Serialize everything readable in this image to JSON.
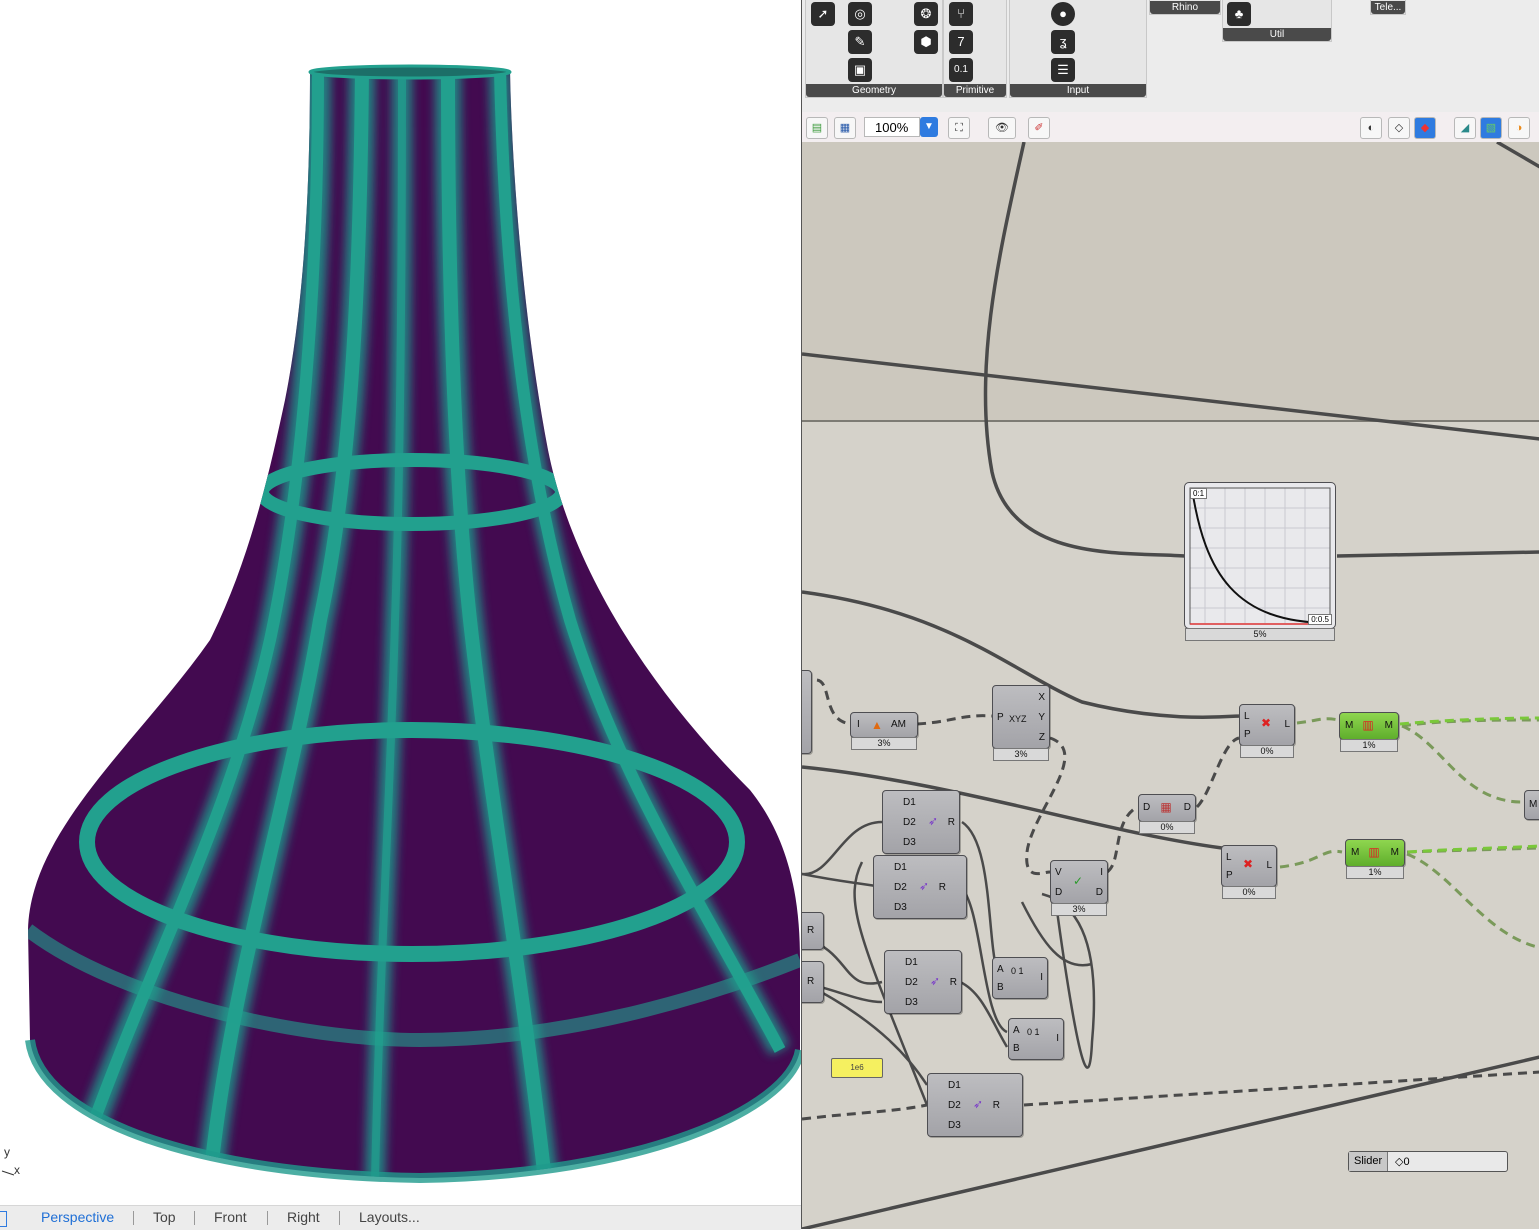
{
  "viewport": {
    "axis_y": "y",
    "axis_x": "x",
    "tabs": [
      "Perspective",
      "Top",
      "Front",
      "Right",
      "Layouts..."
    ],
    "active_tab": "Perspective",
    "colors": {
      "surface": "#430a50",
      "stripe": "#1f9a8c",
      "tab_active": "#1f6fd6"
    }
  },
  "grasshopper": {
    "ribbon": {
      "panels": [
        {
          "label": "Geometry",
          "icons": [
            "arrow-icon",
            "disc-icon",
            "wrench-icon",
            "sphere-icon",
            "panel-icon"
          ]
        },
        {
          "label": "Primitive",
          "icons": [
            "branch-icon",
            "integer-icon",
            "number-icon"
          ],
          "integer_glyph": "7",
          "number_glyph": "0.1"
        },
        {
          "label": "Input",
          "icons": [
            "toggle-icon",
            "gradient-icon",
            "list-icon"
          ]
        },
        {
          "label": "Rhino",
          "icons": []
        },
        {
          "label": "Util",
          "icons": [
            "tree-icon"
          ]
        },
        {
          "label": "Tele...",
          "icons": []
        }
      ]
    },
    "toolbar": {
      "zoom": "100%",
      "zoom_arrow": "▼"
    },
    "canvas": {
      "graph_mapper": {
        "label_tl": "0:1",
        "label_br": "0:0.5",
        "percent": "5%"
      },
      "components": [
        {
          "id": "am",
          "inputs": [
            "I"
          ],
          "outputs": [
            "AM"
          ],
          "percent": "3%"
        },
        {
          "id": "deconstruct",
          "inputs": [
            "P"
          ],
          "outputs": [
            "X",
            "Y",
            "Z"
          ],
          "center": "XYZ",
          "percent": "3%"
        },
        {
          "id": "cull1",
          "inputs": [
            "L",
            "P"
          ],
          "outputs": [
            "L"
          ],
          "percent": "0%"
        },
        {
          "id": "cull2",
          "inputs": [
            "L",
            "P"
          ],
          "outputs": [
            "L"
          ],
          "percent": "0%"
        },
        {
          "id": "mesh1",
          "inputs": [
            "M"
          ],
          "outputs": [
            "M"
          ],
          "percent": "1%"
        },
        {
          "id": "mesh2",
          "inputs": [
            "M"
          ],
          "outputs": [
            "M"
          ],
          "percent": "1%"
        },
        {
          "id": "dd",
          "inputs": [
            "D"
          ],
          "outputs": [
            "D"
          ],
          "percent": "0%"
        },
        {
          "id": "vd",
          "inputs": [
            "V",
            "D"
          ],
          "outputs": [
            "I",
            "D"
          ],
          "percent": "3%"
        },
        {
          "id": "rg1",
          "inputs": [
            "D1",
            "D2",
            "D3"
          ],
          "outputs": [
            "R"
          ],
          "percent": ""
        },
        {
          "id": "rg2",
          "inputs": [
            "D1",
            "D2",
            "D3"
          ],
          "outputs": [
            "R"
          ],
          "percent": ""
        },
        {
          "id": "rg3",
          "inputs": [
            "D1",
            "D2",
            "D3"
          ],
          "outputs": [
            "R"
          ],
          "percent": ""
        },
        {
          "id": "rg4",
          "inputs": [
            "D1",
            "D2",
            "D3"
          ],
          "outputs": [
            "R"
          ],
          "percent": ""
        },
        {
          "id": "ab1",
          "inputs": [
            "A",
            "B"
          ],
          "outputs": [
            "I"
          ],
          "center": "0 1"
        },
        {
          "id": "ab2",
          "inputs": [
            "A",
            "B"
          ],
          "outputs": [
            "I"
          ],
          "center": "0 1"
        }
      ],
      "edge_r_labels": [
        "R",
        "R"
      ],
      "panel_value": "1e6",
      "slider": {
        "label": "Slider",
        "value": "◇0"
      },
      "right_edge_label": "M"
    }
  }
}
